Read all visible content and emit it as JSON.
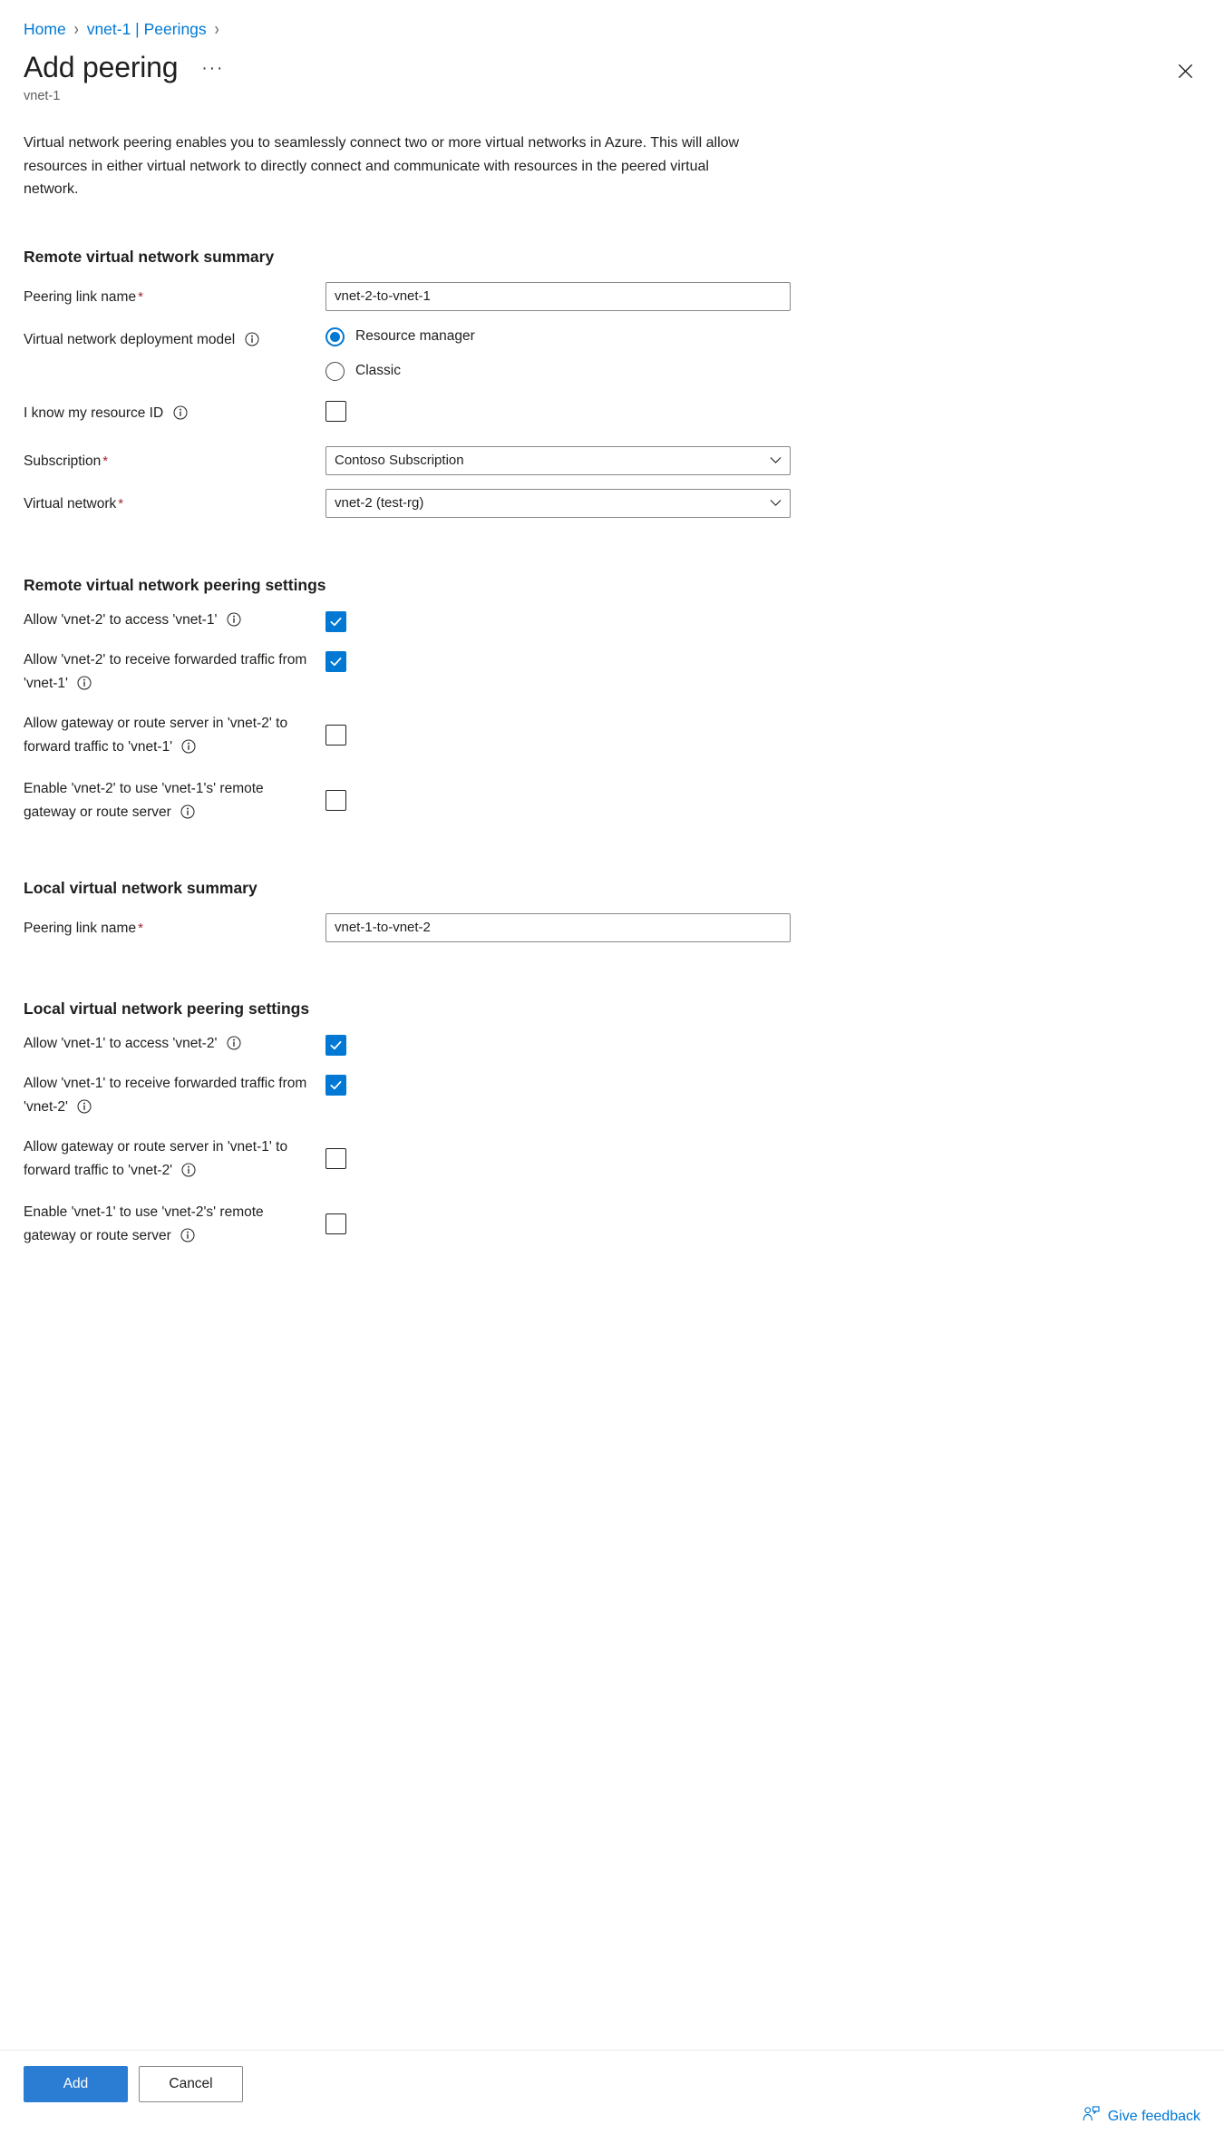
{
  "breadcrumb": {
    "items": [
      {
        "label": "Home"
      },
      {
        "label": "vnet-1 | Peerings"
      }
    ],
    "separator": "›"
  },
  "header": {
    "title": "Add peering",
    "subtitle": "vnet-1",
    "more_label": "···",
    "close_icon": "close-icon"
  },
  "description": "Virtual network peering enables you to seamlessly connect two or more virtual networks in Azure. This will allow resources in either virtual network to directly connect and communicate with resources in the peered virtual network.",
  "remote_summary": {
    "heading": "Remote virtual network summary",
    "peering_link_name": {
      "label": "Peering link name",
      "required": "*",
      "value": "vnet-2-to-vnet-1",
      "placeholder": ""
    },
    "deployment_model": {
      "label": "Virtual network deployment model",
      "info": "info-icon",
      "options": [
        {
          "label": "Resource manager",
          "checked": true
        },
        {
          "label": "Classic",
          "checked": false
        }
      ]
    },
    "resource_id": {
      "label": "I know my resource ID",
      "info": "info-icon",
      "checked": false
    },
    "subscription": {
      "label": "Subscription",
      "required": "*",
      "value": "Contoso Subscription"
    },
    "virtual_network": {
      "label": "Virtual network",
      "required": "*",
      "value": "vnet-2 (test-rg)"
    }
  },
  "remote_settings": {
    "heading": "Remote virtual network peering settings",
    "items": [
      {
        "label": "Allow 'vnet-2' to access 'vnet-1'",
        "checked": true
      },
      {
        "label": "Allow 'vnet-2' to receive forwarded traffic from 'vnet-1'",
        "checked": true
      },
      {
        "label": "Allow gateway or route server in 'vnet-2' to forward traffic to 'vnet-1'",
        "checked": false
      },
      {
        "label": "Enable 'vnet-2' to use 'vnet-1's' remote gateway or route server",
        "checked": false
      }
    ]
  },
  "local_summary": {
    "heading": "Local virtual network summary",
    "peering_link_name": {
      "label": "Peering link name",
      "required": "*",
      "value": "vnet-1-to-vnet-2",
      "placeholder": ""
    }
  },
  "local_settings": {
    "heading": "Local virtual network peering settings",
    "items": [
      {
        "label": "Allow 'vnet-1' to access 'vnet-2'",
        "checked": true
      },
      {
        "label": "Allow 'vnet-1' to receive forwarded traffic from 'vnet-2'",
        "checked": true
      },
      {
        "label": "Allow gateway or route server in 'vnet-1' to forward traffic to 'vnet-2'",
        "checked": false
      },
      {
        "label": "Enable 'vnet-1' to use 'vnet-2's' remote gateway or route server",
        "checked": false
      }
    ]
  },
  "footer": {
    "add_label": "Add",
    "cancel_label": "Cancel",
    "feedback_label": "Give feedback",
    "feedback_icon": "person-feedback-icon"
  },
  "colors": {
    "accent": "#0078d4",
    "primary_button": "#2b7cd3",
    "required_star": "#a4262c",
    "link": "#0078d4",
    "text": "#201f1e",
    "subtle_text": "#605e5c",
    "border": "#8a8886"
  }
}
